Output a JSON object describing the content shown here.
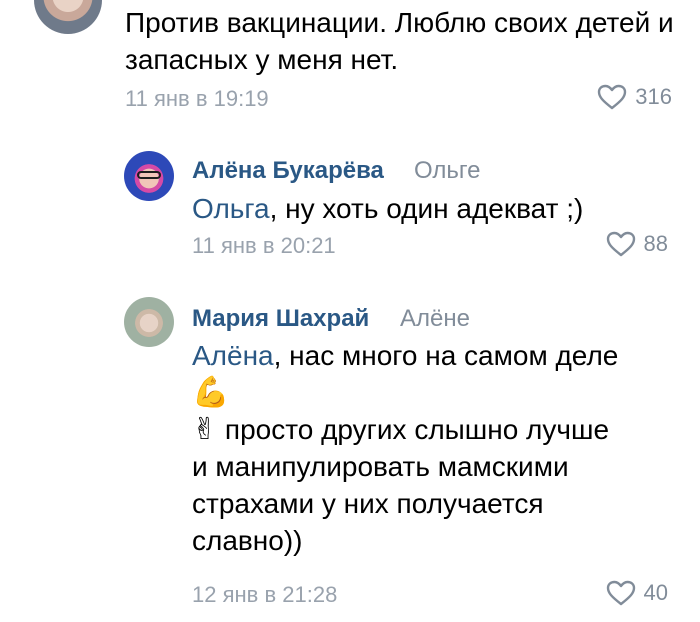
{
  "comments": [
    {
      "text": "Против вакцинации. Люблю своих детей и запасных у меня нет.",
      "date": "11 янв в 19:19",
      "likes": "316"
    },
    {
      "author": "Алёна Букарёва",
      "reply_to": "Ольге",
      "mention": "Ольга",
      "text_rest": ", ну хоть один адекват ;)",
      "date": "11 янв в 20:21",
      "likes": "88"
    },
    {
      "author": "Мария Шахрай",
      "reply_to": "Алёне",
      "mention": "Алёна",
      "text_rest_1": ", нас много на самом деле",
      "emoji_1": "💪",
      "emoji_2": "✌",
      "text_rest_2": " просто других слышно лучше",
      "text_rest_3": "и манипулировать мамскими",
      "text_rest_4": "страхами у них получается",
      "text_rest_5": "славно))",
      "date": "12 янв в 21:28",
      "likes": "40"
    }
  ],
  "colors": {
    "author": "#2a5885",
    "meta": "#99a2ad",
    "likes": "#818c99"
  },
  "icons": {
    "like": "heart-outline-icon"
  }
}
